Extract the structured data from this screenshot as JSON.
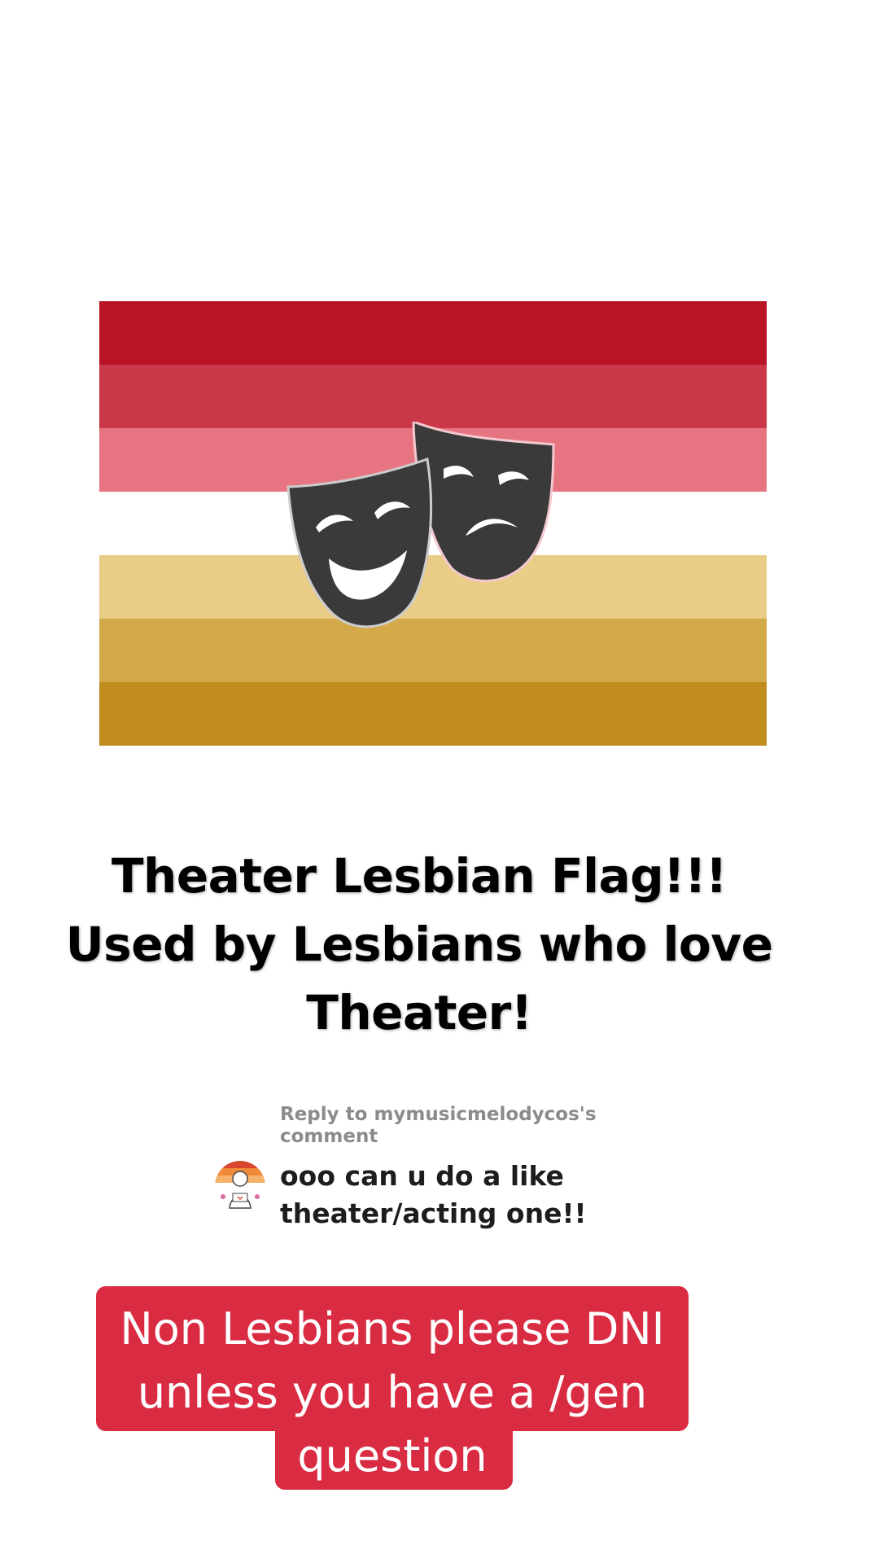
{
  "flag": {
    "stripes": [
      "#b91326",
      "#cb3849",
      "#e67581",
      "#ffffff",
      "#e9cd86",
      "#d4a94a",
      "#c08c1e"
    ],
    "mask_color": "#3a3a3a",
    "mask_icon": "theater-masks-icon"
  },
  "headline": {
    "line1": "Theater Lesbian Flag!!!",
    "line2": "Used by Lesbians who love",
    "line3": "Theater!"
  },
  "reply": {
    "reply_to_line1": "Reply to mymusicmelodycos's",
    "reply_to_line2": "comment",
    "comment_line1": "ooo can u do a like",
    "comment_line2": "theater/acting one!!",
    "avatar_icon": "user-avatar-icon"
  },
  "caption": {
    "line1": "Non Lesbians please DNI",
    "line2": "unless you have a /gen",
    "line3": "question",
    "background": "#d92c43"
  }
}
